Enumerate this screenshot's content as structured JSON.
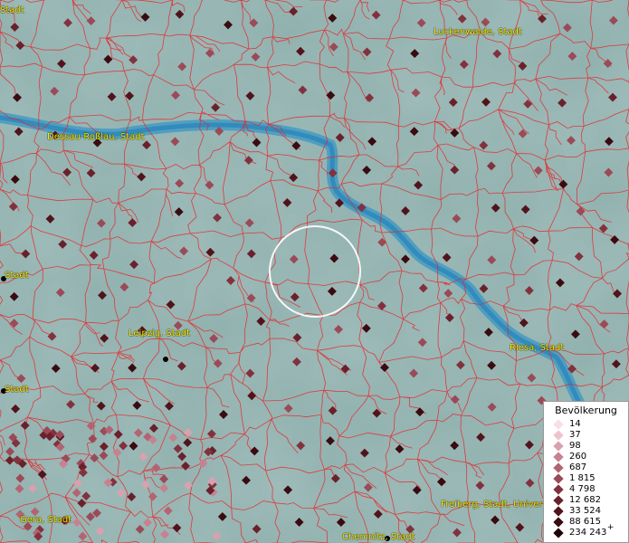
{
  "map": {
    "cities": [
      {
        "name": "Stadt",
        "id": "stadt-nw"
      },
      {
        "name": "Luckenwalde, Stadt",
        "id": "luckenwalde"
      },
      {
        "name": "Dessau-Roßlau, Stadt",
        "id": "dessau"
      },
      {
        "name": "Stadt",
        "id": "stadt-w1"
      },
      {
        "name": "Leipzig, Stadt",
        "id": "leipzig"
      },
      {
        "name": "Stadt",
        "id": "stadt-w2"
      },
      {
        "name": "Riesa, Stadt",
        "id": "riesa"
      },
      {
        "name": "Gera, Stadt",
        "id": "gera"
      },
      {
        "name": "Freiberg, Stadt, Univer",
        "id": "freiberg"
      },
      {
        "name": "Chemnitz, Stadt",
        "id": "chemnitz"
      }
    ],
    "colors": {
      "background": "#8fb0ad",
      "borders": "#e8262c",
      "river": "#3a97c4",
      "label": "#ffee00",
      "selection_circle": "#ffffff"
    }
  },
  "legend": {
    "title": "Bevölkerung",
    "items": [
      {
        "label": "14",
        "color": "#f7dfe8"
      },
      {
        "label": "37",
        "color": "#eec3cf"
      },
      {
        "label": "98",
        "color": "#d9a1ae"
      },
      {
        "label": "260",
        "color": "#c7818f"
      },
      {
        "label": "687",
        "color": "#b26472"
      },
      {
        "label": "1 815",
        "color": "#9b4a57"
      },
      {
        "label": "4 798",
        "color": "#82323e"
      },
      {
        "label": "12 682",
        "color": "#6a212b"
      },
      {
        "label": "33 524",
        "color": "#52141c"
      },
      {
        "label": "88 615",
        "color": "#3a0b10"
      },
      {
        "label": "234 243",
        "color": "#1f0407"
      }
    ],
    "last_suffix": "+"
  }
}
